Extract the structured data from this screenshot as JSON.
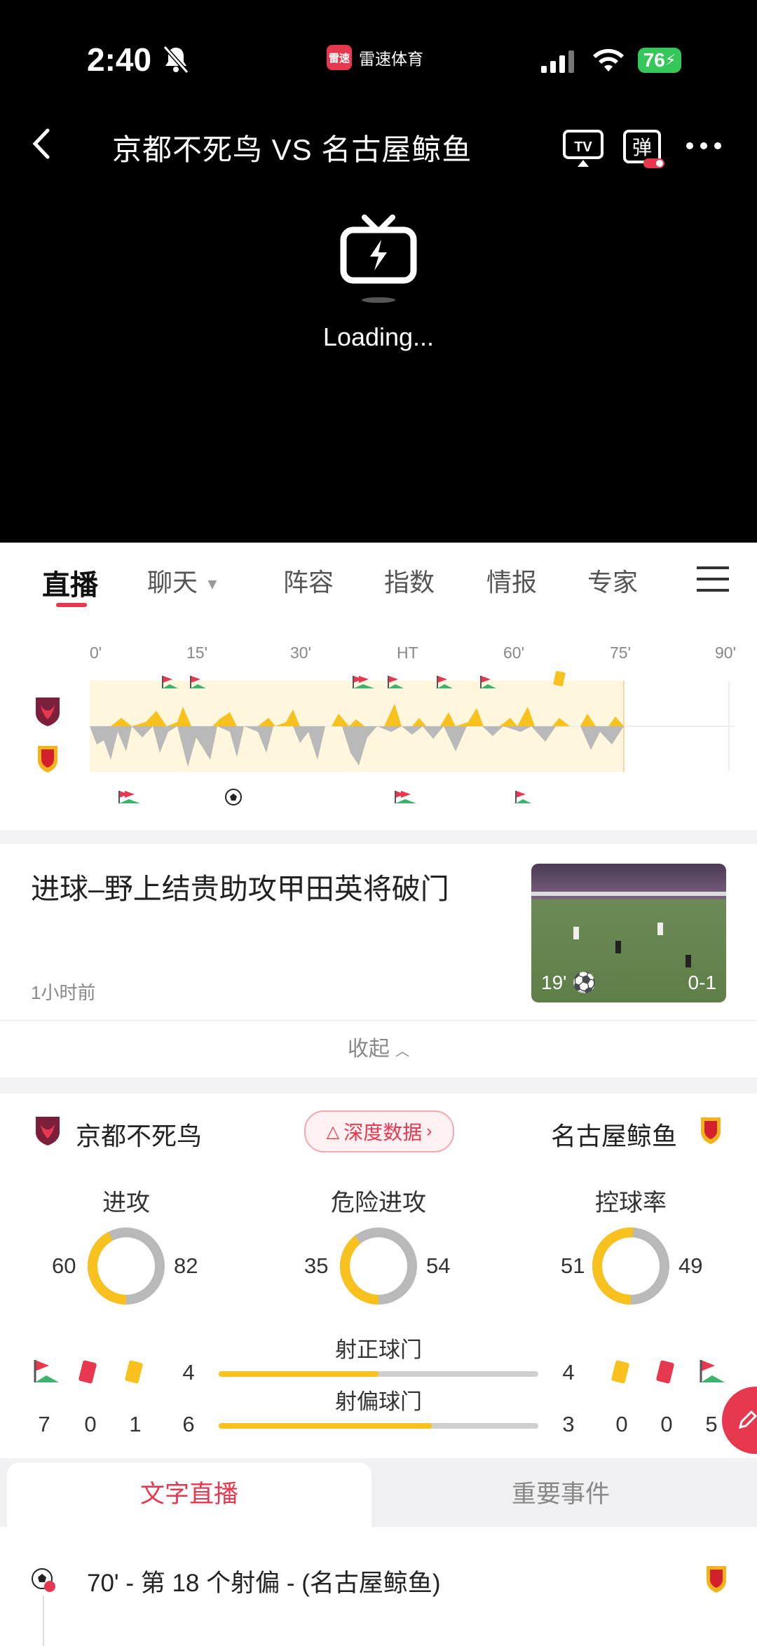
{
  "status_bar": {
    "time": "2:40",
    "app_name": "雷速体育",
    "app_logo": "雷速",
    "battery": "76"
  },
  "header": {
    "title": "京都不死鸟 VS 名古屋鲸鱼",
    "tv_label": "TV",
    "danmu_label": "弹",
    "loading": "Loading..."
  },
  "tabs": [
    "直播",
    "聊天",
    "阵容",
    "指数",
    "情报",
    "专家"
  ],
  "timeline": {
    "ticks": [
      "0'",
      "15'",
      "30'",
      "HT",
      "60'",
      "75'",
      "90'"
    ]
  },
  "goal": {
    "title": "进球–野上结贵助攻甲田英将破门",
    "time_ago": "1小时前",
    "minute": "19'",
    "score": "0-1"
  },
  "collapse_label": "收起",
  "stats": {
    "home_team": "京都不死鸟",
    "away_team": "名古屋鲸鱼",
    "deep_data_label": "深度数据",
    "rings": [
      {
        "label": "进攻",
        "home": "60",
        "away": "82"
      },
      {
        "label": "危险进攻",
        "home": "35",
        "away": "54"
      },
      {
        "label": "控球率",
        "home": "51",
        "away": "49"
      }
    ],
    "shots_on_target": {
      "label": "射正球门",
      "home": "4",
      "away": "4",
      "home_share": 0.5
    },
    "shots_off_target": {
      "label": "射偏球门",
      "home": "6",
      "away": "3",
      "home_share": 0.667
    },
    "home_counts": {
      "corners": "7",
      "red": "0",
      "yellow": "1"
    },
    "away_counts": {
      "yellow": "0",
      "red": "0",
      "corners": "5"
    }
  },
  "bottom_tabs": {
    "text_live": "文字直播",
    "key_events": "重要事件"
  },
  "feed": {
    "entry": "70' - 第 18 个射偏 - (名古屋鲸鱼)"
  },
  "colors": {
    "accent": "#e8384f",
    "yellow": "#f8c11d",
    "grey": "#b9b9b9"
  }
}
